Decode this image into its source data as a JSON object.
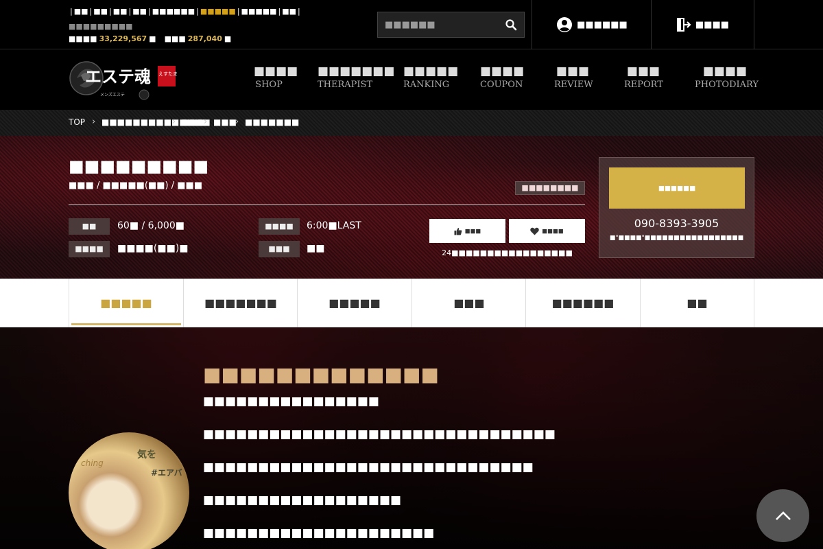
{
  "topbar": {
    "regions": [
      "■■",
      "■■",
      "■■",
      "■■",
      "■■■■■■",
      "■■■■■",
      "■■■■■",
      "■■"
    ],
    "regions_active_index": 5,
    "site_desc": "■■■■■■■■■",
    "stats": {
      "label1": "■■■■",
      "value1": "33,229,567",
      "unit1": "■",
      "label2": "■■■",
      "value2": "287,040",
      "unit2": "■"
    },
    "search_placeholder": "■■■■■■",
    "login_label": "■■■■■■",
    "register_label": "■■■■"
  },
  "logo": {
    "main": "エステ魂",
    "badge": "えすたま",
    "sub": "メンズエステ"
  },
  "nav": [
    {
      "jp": "■■■■",
      "en": "SHOP"
    },
    {
      "jp": "■■■■■■■",
      "en": "THERAPIST"
    },
    {
      "jp": "■■■■■",
      "en": "RANKING"
    },
    {
      "jp": "■■■■",
      "en": "COUPON"
    },
    {
      "jp": "■■■",
      "en": "REVIEW"
    },
    {
      "jp": "■■■",
      "en": "REPORT"
    },
    {
      "jp": "■■■■",
      "en": "PHOTODIARY"
    }
  ],
  "breadcrumb": [
    "TOP",
    "■■■■■■■■■■■■■■",
    "■■■",
    "■■■",
    "■■■■■■■"
  ],
  "shop": {
    "title": "■■■■■■■■■",
    "subtitle": "■■■ / ■■■■■(■■) / ■■■",
    "tag": "■■■■■■■■",
    "info": [
      {
        "label": "■■",
        "value": "60■ / 6,000■"
      },
      {
        "label": "■■■■",
        "value": "■■■■(■■)■"
      },
      {
        "label": "■■■■",
        "value": "6:00■LAST"
      },
      {
        "label": "■■■",
        "value": "■■"
      }
    ],
    "like_label": "■■■",
    "fav_label": "■■■■",
    "action_note": "24■■■■■■■■■■■■■■■■■",
    "call_label": "■■■■■■",
    "phone": "090-8393-3905",
    "call_note": "■\"■■■■\"■■■■■■■■■■■■■■■■■"
  },
  "tabs": [
    "■■■■■",
    "■■■■■■■",
    "■■■■■",
    "■■■",
    "■■■■■■",
    "■■"
  ],
  "tabs_active_index": 0,
  "content": {
    "title": "■■■■■■■■■■■■■",
    "lines": [
      "■■■■■■■■■■■■■■■■",
      "■■■■■■■■■■■■■■■■■■■■■■■■■■■■■■■■",
      "■■■■■■■■■■■■■■■■■■■■■■■■■■■■■■",
      "■■■■■■■■■■■■■■■■■■",
      "■■■■■■■■■■■■■■■■■■■■■"
    ],
    "image_text1": "気を",
    "image_text2": "ching",
    "image_text3": "#エアバ"
  },
  "colors": {
    "accent_gold": "#d4b248",
    "tab_active": "#c9a640",
    "label_bg": "#4a3a3a",
    "stat_gold": "#d8b45a"
  },
  "icons": [
    "search-icon",
    "user-icon",
    "register-icon",
    "thumbs-up-icon",
    "heart-icon",
    "chevron-up-icon"
  ]
}
